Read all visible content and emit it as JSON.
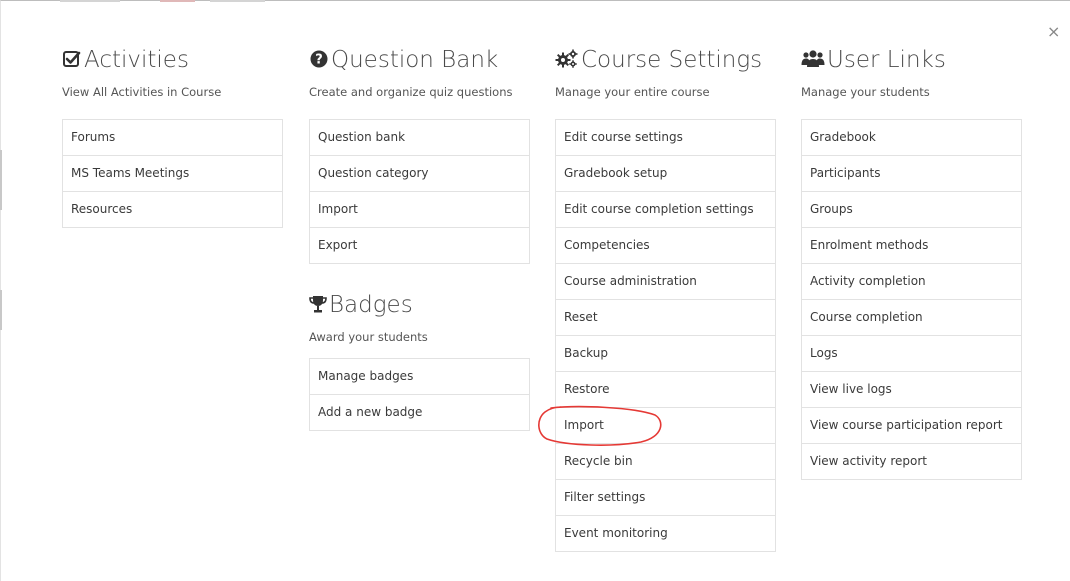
{
  "close_label": "×",
  "accent_color": "#e53935",
  "columns": [
    {
      "title": "Activities",
      "icon": "check-square-icon",
      "subtitle": "View All Activities in Course",
      "items": [
        "Forums",
        "MS Teams Meetings",
        "Resources"
      ]
    },
    {
      "title": "Question Bank",
      "icon": "question-circle-icon",
      "subtitle": "Create and organize quiz questions",
      "items": [
        "Question bank",
        "Question category",
        "Import",
        "Export"
      ]
    },
    {
      "title": "Course Settings",
      "icon": "cogs-icon",
      "subtitle": "Manage your entire course",
      "items": [
        "Edit course settings",
        "Gradebook setup",
        "Edit course completion settings",
        "Competencies",
        "Course administration",
        "Reset",
        "Backup",
        "Restore",
        "Import",
        "Recycle bin",
        "Filter settings",
        "Event monitoring"
      ]
    },
    {
      "title": "User Links",
      "icon": "users-icon",
      "subtitle": "Manage your students",
      "items": [
        "Gradebook",
        "Participants",
        "Groups",
        "Enrolment methods",
        "Activity completion",
        "Course completion",
        "Logs",
        "View live logs",
        "View course participation report",
        "View activity report"
      ]
    }
  ],
  "badges": {
    "title": "Badges",
    "icon": "trophy-icon",
    "subtitle": "Award your students",
    "items": [
      "Manage badges",
      "Add a new badge"
    ]
  }
}
